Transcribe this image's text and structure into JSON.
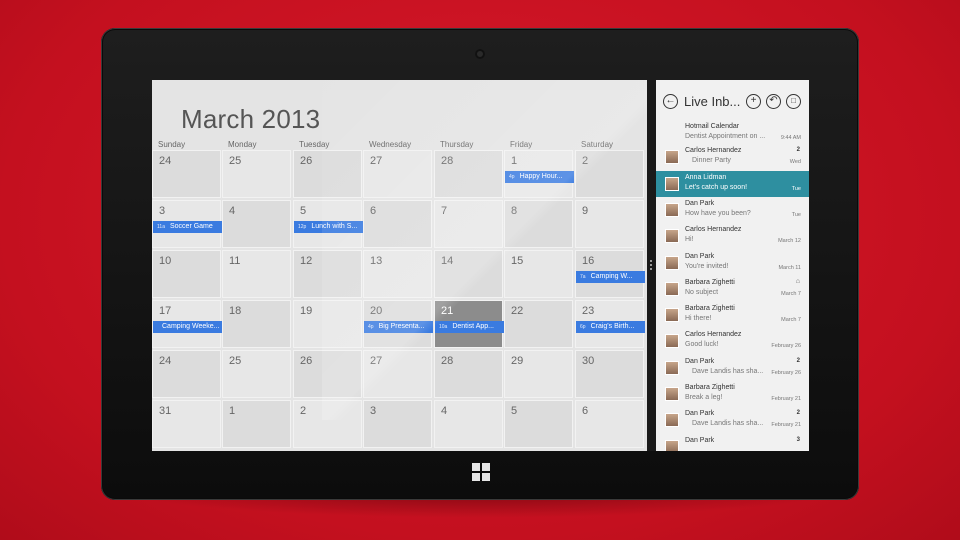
{
  "calendar": {
    "title": "March 2013",
    "days_of_week": [
      "Sunday",
      "Monday",
      "Tuesday",
      "Wednesday",
      "Thursday",
      "Friday",
      "Saturday"
    ],
    "weeks": [
      [
        {
          "day": "24"
        },
        {
          "day": "25"
        },
        {
          "day": "26"
        },
        {
          "day": "27"
        },
        {
          "day": "28"
        },
        {
          "day": "1",
          "event": {
            "time": "4p",
            "title": "Happy Hour..."
          }
        },
        {
          "day": "2"
        }
      ],
      [
        {
          "day": "3",
          "event": {
            "time": "11a",
            "title": "Soccer Game"
          }
        },
        {
          "day": "4"
        },
        {
          "day": "5",
          "event": {
            "time": "12p",
            "title": "Lunch with S..."
          }
        },
        {
          "day": "6"
        },
        {
          "day": "7"
        },
        {
          "day": "8"
        },
        {
          "day": "9"
        }
      ],
      [
        {
          "day": "10"
        },
        {
          "day": "11"
        },
        {
          "day": "12"
        },
        {
          "day": "13"
        },
        {
          "day": "14"
        },
        {
          "day": "15"
        },
        {
          "day": "16",
          "event": {
            "time": "7a",
            "title": "Camping W..."
          }
        }
      ],
      [
        {
          "day": "17",
          "event": {
            "time": "",
            "title": "Camping Weeke..."
          }
        },
        {
          "day": "18"
        },
        {
          "day": "19"
        },
        {
          "day": "20",
          "event": {
            "time": "4p",
            "title": "Big Presenta..."
          }
        },
        {
          "day": "21",
          "today": true,
          "event": {
            "time": "10a",
            "title": "Dentist App..."
          }
        },
        {
          "day": "22"
        },
        {
          "day": "23",
          "event": {
            "time": "6p",
            "title": "Craig's Birth..."
          }
        }
      ],
      [
        {
          "day": "24"
        },
        {
          "day": "25"
        },
        {
          "day": "26"
        },
        {
          "day": "27"
        },
        {
          "day": "28"
        },
        {
          "day": "29"
        },
        {
          "day": "30"
        }
      ],
      [
        {
          "day": "31"
        },
        {
          "day": "1"
        },
        {
          "day": "2"
        },
        {
          "day": "3"
        },
        {
          "day": "4"
        },
        {
          "day": "5"
        },
        {
          "day": "6"
        }
      ]
    ]
  },
  "mail": {
    "title": "Live Inb...",
    "icons": {
      "back": "back-arrow-icon",
      "new": "plus-icon",
      "reply": "reply-icon",
      "delete": "trash-icon"
    },
    "messages": [
      {
        "from": "Hotmail Calendar",
        "subject": "Dentist Appointment on ...",
        "date": "9:44 AM",
        "count": "",
        "selected": false,
        "attachment": false
      },
      {
        "from": "Carlos Hernandez",
        "subject": "Dinner Party",
        "date": "Wed",
        "count": "2",
        "selected": false,
        "attachment": false,
        "indent": true
      },
      {
        "from": "Anna Lidman",
        "subject": "Let's catch up soon!",
        "date": "Tue",
        "count": "",
        "selected": true,
        "attachment": false
      },
      {
        "from": "Dan Park",
        "subject": "How have you been?",
        "date": "Tue",
        "count": "",
        "selected": false,
        "attachment": false
      },
      {
        "from": "Carlos Hernandez",
        "subject": "Hi!",
        "date": "March 12",
        "count": "",
        "selected": false,
        "attachment": false
      },
      {
        "from": "Dan Park",
        "subject": "You're invited!",
        "date": "March 11",
        "count": "",
        "selected": false,
        "attachment": false
      },
      {
        "from": "Barbara Zighetti",
        "subject": "No subject",
        "date": "March 7",
        "count": "",
        "selected": false,
        "attachment": true
      },
      {
        "from": "Barbara Zighetti",
        "subject": "Hi there!",
        "date": "March 7",
        "count": "",
        "selected": false,
        "attachment": false
      },
      {
        "from": "Carlos Hernandez",
        "subject": "Good luck!",
        "date": "February 26",
        "count": "",
        "selected": false,
        "attachment": false
      },
      {
        "from": "Dan Park",
        "subject": "Dave Landis has sha...",
        "date": "February 26",
        "count": "2",
        "selected": false,
        "attachment": false,
        "indent": true
      },
      {
        "from": "Barbara Zighetti",
        "subject": "Break a leg!",
        "date": "February 21",
        "count": "",
        "selected": false,
        "attachment": false
      },
      {
        "from": "Dan Park",
        "subject": "Dave Landis has sha...",
        "date": "February 21",
        "count": "2",
        "selected": false,
        "attachment": false,
        "indent": true
      },
      {
        "from": "Dan Park",
        "subject": "",
        "date": "",
        "count": "3",
        "selected": false,
        "attachment": false
      }
    ]
  },
  "colors": {
    "background": "#c4101f",
    "event": "#3a7be0",
    "selected_mail": "#2e8fa0",
    "today_cell": "#8c8c8c"
  }
}
